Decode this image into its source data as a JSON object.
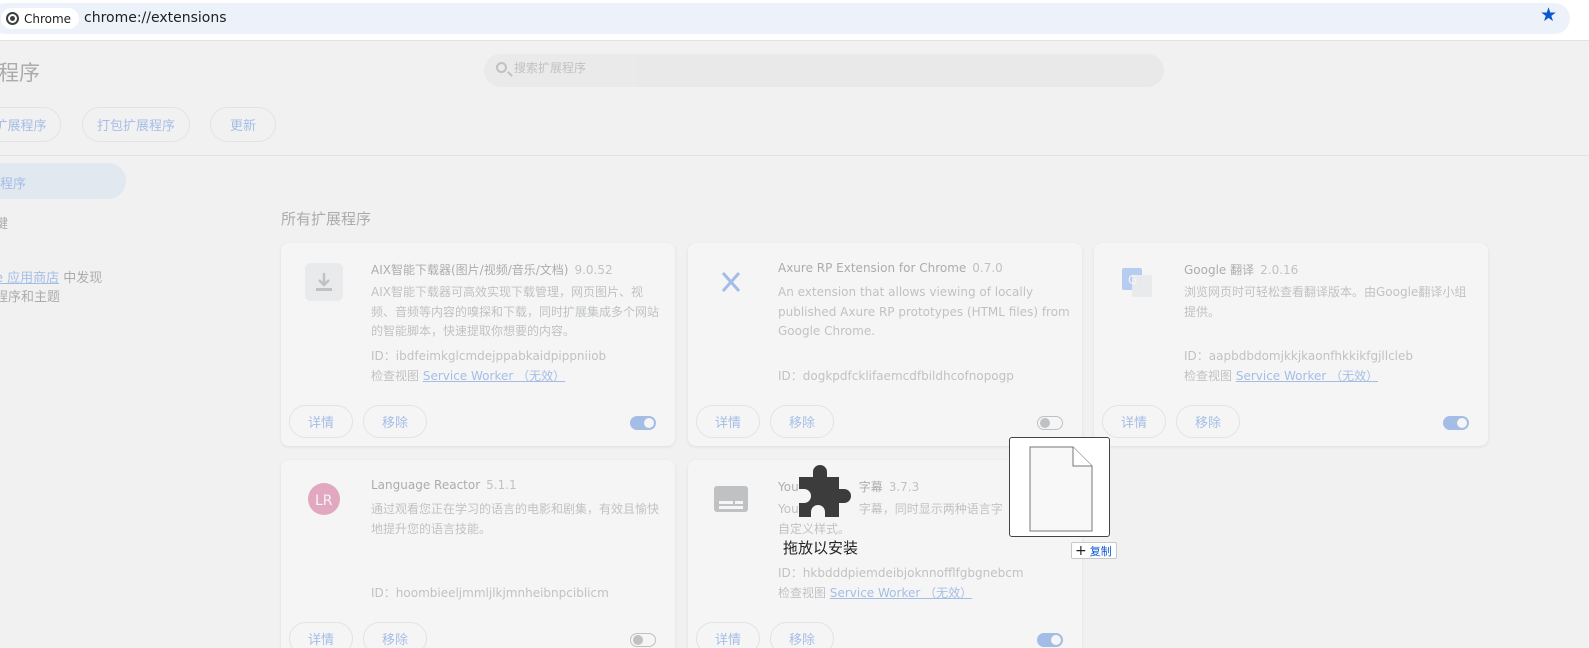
{
  "browser": {
    "chip_label": "Chrome",
    "url": "chrome://extensions"
  },
  "page": {
    "title": "程序",
    "search_placeholder": "搜索扩展程序",
    "toolbar": {
      "load_label": "扩展程序",
      "pack_label": "打包扩展程序",
      "update_label": "更新"
    },
    "sidebar": {
      "active_label": "程序",
      "shortcuts_label": "键",
      "store_link": "e 应用商店",
      "store_suffix": " 中发现",
      "store_line2": "程序和主题"
    },
    "section_title": "所有扩展程序",
    "card_buttons": {
      "details": "详情",
      "remove": "移除"
    },
    "extensions": [
      {
        "name": "AIX智能下载器(图片/视频/音乐/文档)",
        "version": "9.0.52",
        "description": "AIX智能下载器可高效实现下载管理，网页图片、视频、音频等内容的嗅探和下载，同时扩展集成多个网站的智能脚本，快速提取你想要的内容。",
        "id_label": "ID：",
        "id": "ibdfeimkglcmdejppabkaidpippniiob",
        "view_label": "检查视图",
        "view_link": "Service Worker （无效）",
        "enabled": true,
        "icon": "download-icon",
        "color": "#5f6368"
      },
      {
        "name": "Axure RP Extension for Chrome",
        "version": "0.7.0",
        "description": "An extension that allows viewing of locally published Axure RP prototypes (HTML files) from Google Chrome.",
        "id_label": "ID：",
        "id": "dogkpdfcklifaemcdfbildhcofnopogp",
        "view_label": "",
        "view_link": "",
        "enabled": false,
        "icon": "axure-icon",
        "color": "#0b57d0"
      },
      {
        "name": "Google 翻译",
        "version": "2.0.16",
        "description": "浏览网页时可轻松查看翻译版本。由Google翻译小组提供。",
        "id_label": "ID：",
        "id": "aapbdbdomjkkjkaonfhkkikfgjllcleb",
        "view_label": "检查视图",
        "view_link": "Service Worker （无效）",
        "enabled": true,
        "icon": "google-translate-icon",
        "color": "#4285f4"
      },
      {
        "name": "Language Reactor",
        "version": "5.1.1",
        "description": "通过观看您正在学习的语言的电影和剧集，有效且愉快地提升您的语言技能。",
        "id_label": "ID：",
        "id": "hoombieeljmmljlkjmnheibnpciblicm",
        "view_label": "",
        "view_link": "",
        "enabled": false,
        "icon": "language-reactor-icon",
        "color": "#c2185b"
      },
      {
        "name": "You",
        "name_tail": "字幕",
        "version": "3.7.3",
        "description_a": "You",
        "description_b": "字幕，同时显示两种语言字",
        "description_line2": "自定义样式。",
        "id_label": "ID：",
        "id": "hkbdddpiemdeibjoknnofflfgbgnebcm",
        "view_label": "检查视图",
        "view_link": "Service Worker （无效）",
        "enabled": true,
        "icon": "subtitles-icon",
        "color": "#5f6368"
      }
    ]
  },
  "drag": {
    "drop_label": "拖放以安装",
    "copy_label": "复制",
    "puzzle_color": "#3c3c3c"
  }
}
